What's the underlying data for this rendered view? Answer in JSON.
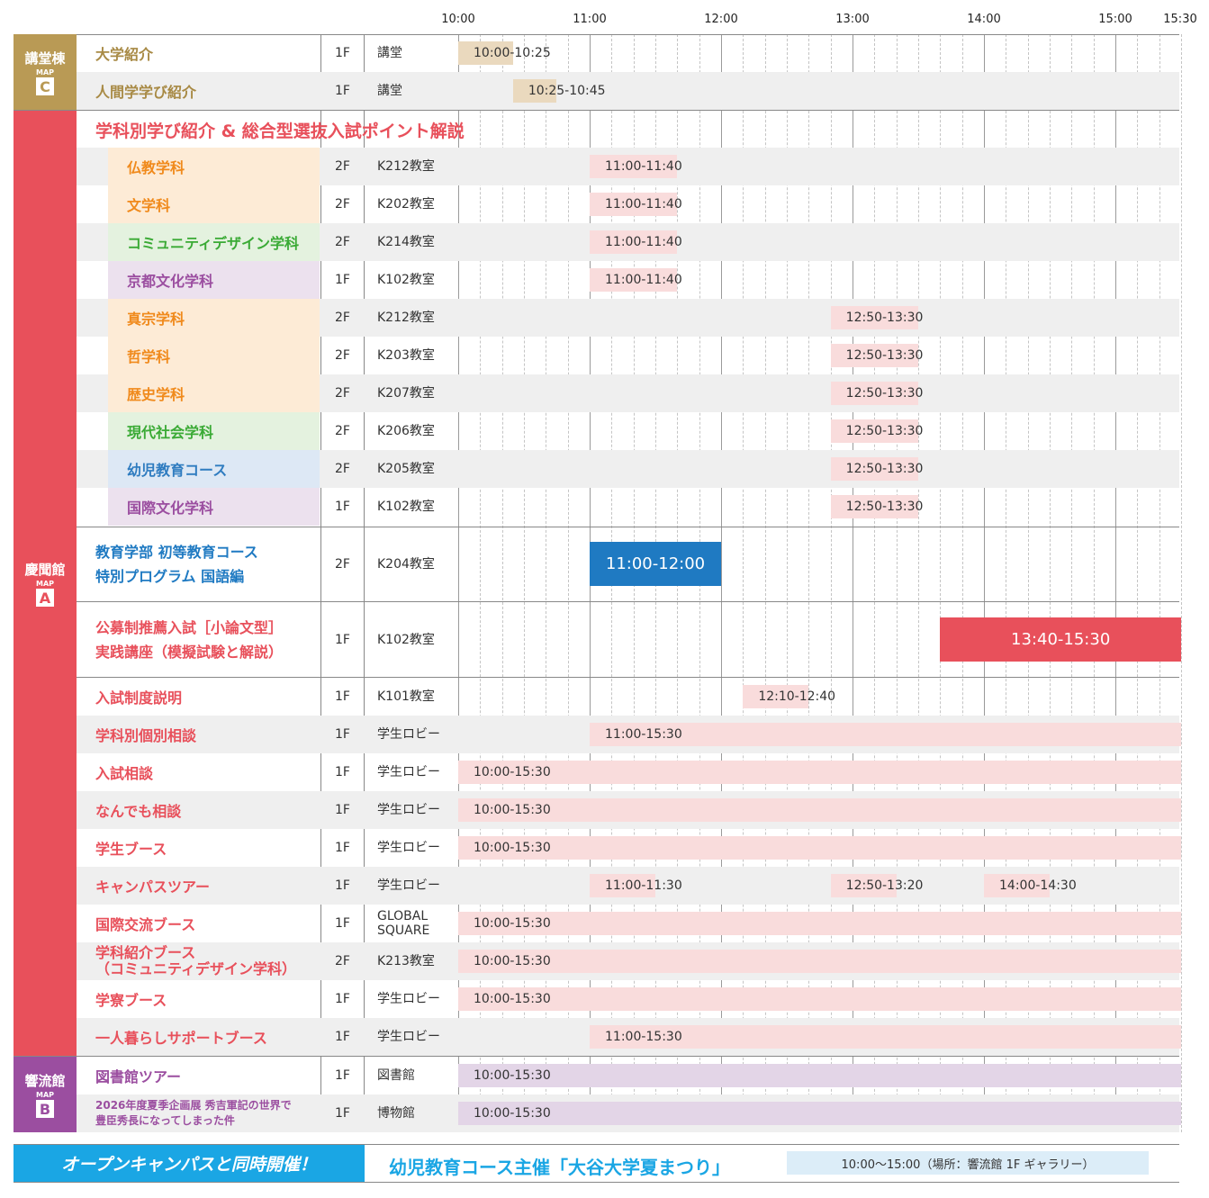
{
  "timeline": {
    "ticks": [
      "10:00",
      "11:00",
      "12:00",
      "13:00",
      "14:00",
      "15:00",
      "15:30"
    ]
  },
  "buildings": [
    {
      "name": "講堂棟",
      "map": "MAP",
      "letter": "C",
      "color": "#b99a55"
    },
    {
      "name": "慶聞館",
      "map": "MAP",
      "letter": "A",
      "color": "#e8505b"
    },
    {
      "name": "響流館",
      "map": "MAP",
      "letter": "B",
      "color": "#9b4ea0"
    }
  ],
  "section_heading": "学科別学び紹介 & 総合型選抜入試ポイント解説",
  "rows": [
    {
      "name": "大学紹介",
      "floor": "1F",
      "room": "講堂",
      "bars": [
        "10:00-10:25"
      ]
    },
    {
      "name": "人間学学び紹介",
      "floor": "1F",
      "room": "講堂",
      "bars": [
        "10:25-10:45"
      ]
    },
    {
      "name": "仏教学科",
      "floor": "2F",
      "room": "K212教室",
      "bars": [
        "11:00-11:40"
      ]
    },
    {
      "name": "文学科",
      "floor": "2F",
      "room": "K202教室",
      "bars": [
        "11:00-11:40"
      ]
    },
    {
      "name": "コミュニティデザイン学科",
      "floor": "2F",
      "room": "K214教室",
      "bars": [
        "11:00-11:40"
      ]
    },
    {
      "name": "京都文化学科",
      "floor": "1F",
      "room": "K102教室",
      "bars": [
        "11:00-11:40"
      ]
    },
    {
      "name": "真宗学科",
      "floor": "2F",
      "room": "K212教室",
      "bars": [
        "12:50-13:30"
      ]
    },
    {
      "name": "哲学科",
      "floor": "2F",
      "room": "K203教室",
      "bars": [
        "12:50-13:30"
      ]
    },
    {
      "name": "歴史学科",
      "floor": "2F",
      "room": "K207教室",
      "bars": [
        "12:50-13:30"
      ]
    },
    {
      "name": "現代社会学科",
      "floor": "2F",
      "room": "K206教室",
      "bars": [
        "12:50-13:30"
      ]
    },
    {
      "name": "幼児教育コース",
      "floor": "2F",
      "room": "K205教室",
      "bars": [
        "12:50-13:30"
      ]
    },
    {
      "name": "国際文化学科",
      "floor": "1F",
      "room": "K102教室",
      "bars": [
        "12:50-13:30"
      ]
    },
    {
      "name_line1": "教育学部 初等教育コース",
      "name_line2": "特別プログラム 国語編",
      "floor": "2F",
      "room": "K204教室",
      "bars": [
        "11:00-12:00"
      ]
    },
    {
      "name_line1": "公募制推薦入試［小論文型］",
      "name_line2": "実践講座（模擬試験と解説）",
      "floor": "1F",
      "room": "K102教室",
      "bars": [
        "13:40-15:30"
      ]
    },
    {
      "name": "入試制度説明",
      "floor": "1F",
      "room": "K101教室",
      "bars": [
        "12:10-12:40"
      ]
    },
    {
      "name": "学科別個別相談",
      "floor": "1F",
      "room": "学生ロビー",
      "bars": [
        "11:00-15:30"
      ]
    },
    {
      "name": "入試相談",
      "floor": "1F",
      "room": "学生ロビー",
      "bars": [
        "10:00-15:30"
      ]
    },
    {
      "name": "なんでも相談",
      "floor": "1F",
      "room": "学生ロビー",
      "bars": [
        "10:00-15:30"
      ]
    },
    {
      "name": "学生ブース",
      "floor": "1F",
      "room": "学生ロビー",
      "bars": [
        "10:00-15:30"
      ]
    },
    {
      "name": "キャンパスツアー",
      "floor": "1F",
      "room": "学生ロビー",
      "bars": [
        "11:00-11:30",
        "12:50-13:20",
        "14:00-14:30"
      ]
    },
    {
      "name": "国際交流ブース",
      "floor": "1F",
      "room_line1": "GLOBAL",
      "room_line2": "SQUARE",
      "bars": [
        "10:00-15:30"
      ]
    },
    {
      "name_line1": "学科紹介ブース",
      "name_line2": "（コミュニティデザイン学科）",
      "floor": "2F",
      "room": "K213教室",
      "bars": [
        "10:00-15:30"
      ]
    },
    {
      "name": "学寮ブース",
      "floor": "1F",
      "room": "学生ロビー",
      "bars": [
        "10:00-15:30"
      ]
    },
    {
      "name": "一人暮らしサポートブース",
      "floor": "1F",
      "room": "学生ロビー",
      "bars": [
        "11:00-15:30"
      ]
    },
    {
      "name": "図書館ツアー",
      "floor": "1F",
      "room": "図書館",
      "bars": [
        "10:00-15:30"
      ]
    },
    {
      "name_line1": "2026年度夏季企画展 秀吉軍記の世界で",
      "name_line2": "豊臣秀長になってしまった件",
      "floor": "1F",
      "room": "博物館",
      "bars": [
        "10:00-15:30"
      ]
    }
  ],
  "footer": {
    "badge": "オープンキャンパスと同時開催！",
    "title": "幼児教育コース主催「大谷大学夏まつり」",
    "detail": "10:00〜15:00（場所：響流館 1F ギャラリー）"
  },
  "colors": {
    "gold": "#b99a55",
    "red": "#e8505b",
    "purple": "#9b4ea0",
    "blue": "#1f7ac2",
    "orange": "#f08a1c",
    "green": "#3aaa35",
    "lavender": "#9b4ea0",
    "lightblue": "#2f7cc0"
  }
}
